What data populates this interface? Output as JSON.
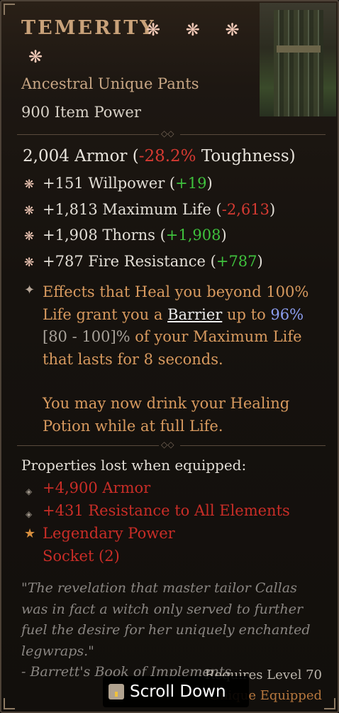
{
  "item": {
    "name": "TEMERITY",
    "stars_row1": "❋ ❋ ❋",
    "stars_row2": "❋",
    "type": "Ancestral Unique Pants",
    "power": "900 Item Power"
  },
  "armor": {
    "value": "2,004 Armor (",
    "delta": "-28.2%",
    "suffix": " Toughness)"
  },
  "affixes": [
    {
      "text": "+151 Willpower (",
      "delta": "+19",
      "close": ")",
      "delta_color": "green"
    },
    {
      "text": "+1,813 Maximum Life (",
      "delta": "-2,613",
      "close": ")",
      "delta_color": "red"
    },
    {
      "text": "+1,908 Thorns (",
      "delta": "+1,908",
      "close": ")",
      "delta_color": "green"
    },
    {
      "text": "+787 Fire Resistance (",
      "delta": "+787",
      "close": ")",
      "delta_color": "green"
    }
  ],
  "legendary": {
    "p1": "Effects that Heal you beyond 100% Life grant you a ",
    "barrier": "Barrier",
    "p2": " up to ",
    "value": "96%",
    "range": " [80 - 100]%",
    "p3": " of your Maximum Life that lasts for 8 seconds.",
    "p4": "You may now drink your Healing Potion while at full Life."
  },
  "lost": {
    "title": "Properties lost when equipped:",
    "items": [
      "+4,900 Armor",
      "+431 Resistance to All Elements",
      "Legendary Power",
      "Socket (2)"
    ]
  },
  "flavor": {
    "quote": "\"The revelation that master tailor Callas was in fact a witch only served to further fuel the desire for her uniquely enchanted legwraps.\"",
    "source": "- Barrett's Book of Implements"
  },
  "footer": {
    "requires": "Requires Level 70",
    "equipped": "Unique Equipped",
    "scroll_label": "Scroll Down"
  },
  "icons": {
    "affix": "affix-gem-icon",
    "legendary": "legendary-sparkle-icon",
    "lost_bullet": "diamond-bullet-icon",
    "lost_star": "star-icon",
    "scroll": "treasure-chest-icon"
  },
  "colors": {
    "title": "#c9a27a",
    "red": "#d53a32",
    "green": "#3fc23d",
    "blue": "#8c9ef0",
    "legendary": "#d89a5f",
    "unique": "#b6773e"
  }
}
